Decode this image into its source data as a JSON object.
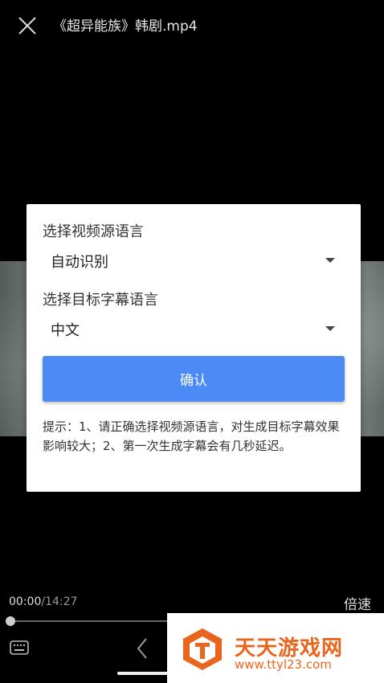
{
  "header": {
    "title": "《超异能族》韩剧.mp4",
    "close_icon": "close-icon"
  },
  "dialog": {
    "source_label": "选择视频源语言",
    "source_selected": "自动识别",
    "target_label": "选择目标字幕语言",
    "target_selected": "中文",
    "confirm_label": "确认",
    "tip": "提示：1、请正确选择视频源语言，对生成目标字幕效果影响较大；2、第一次生成字幕会有几秒延迟。"
  },
  "player": {
    "current_time": "00:00",
    "total_time": "/14:27",
    "speed_label": "倍速",
    "progress": 0
  },
  "watermark": {
    "title": "天天游戏网",
    "url": "www.ttyl23.com"
  },
  "colors": {
    "accent": "#4c8bf5",
    "watermark": "#e9651e",
    "background": "#000000"
  }
}
